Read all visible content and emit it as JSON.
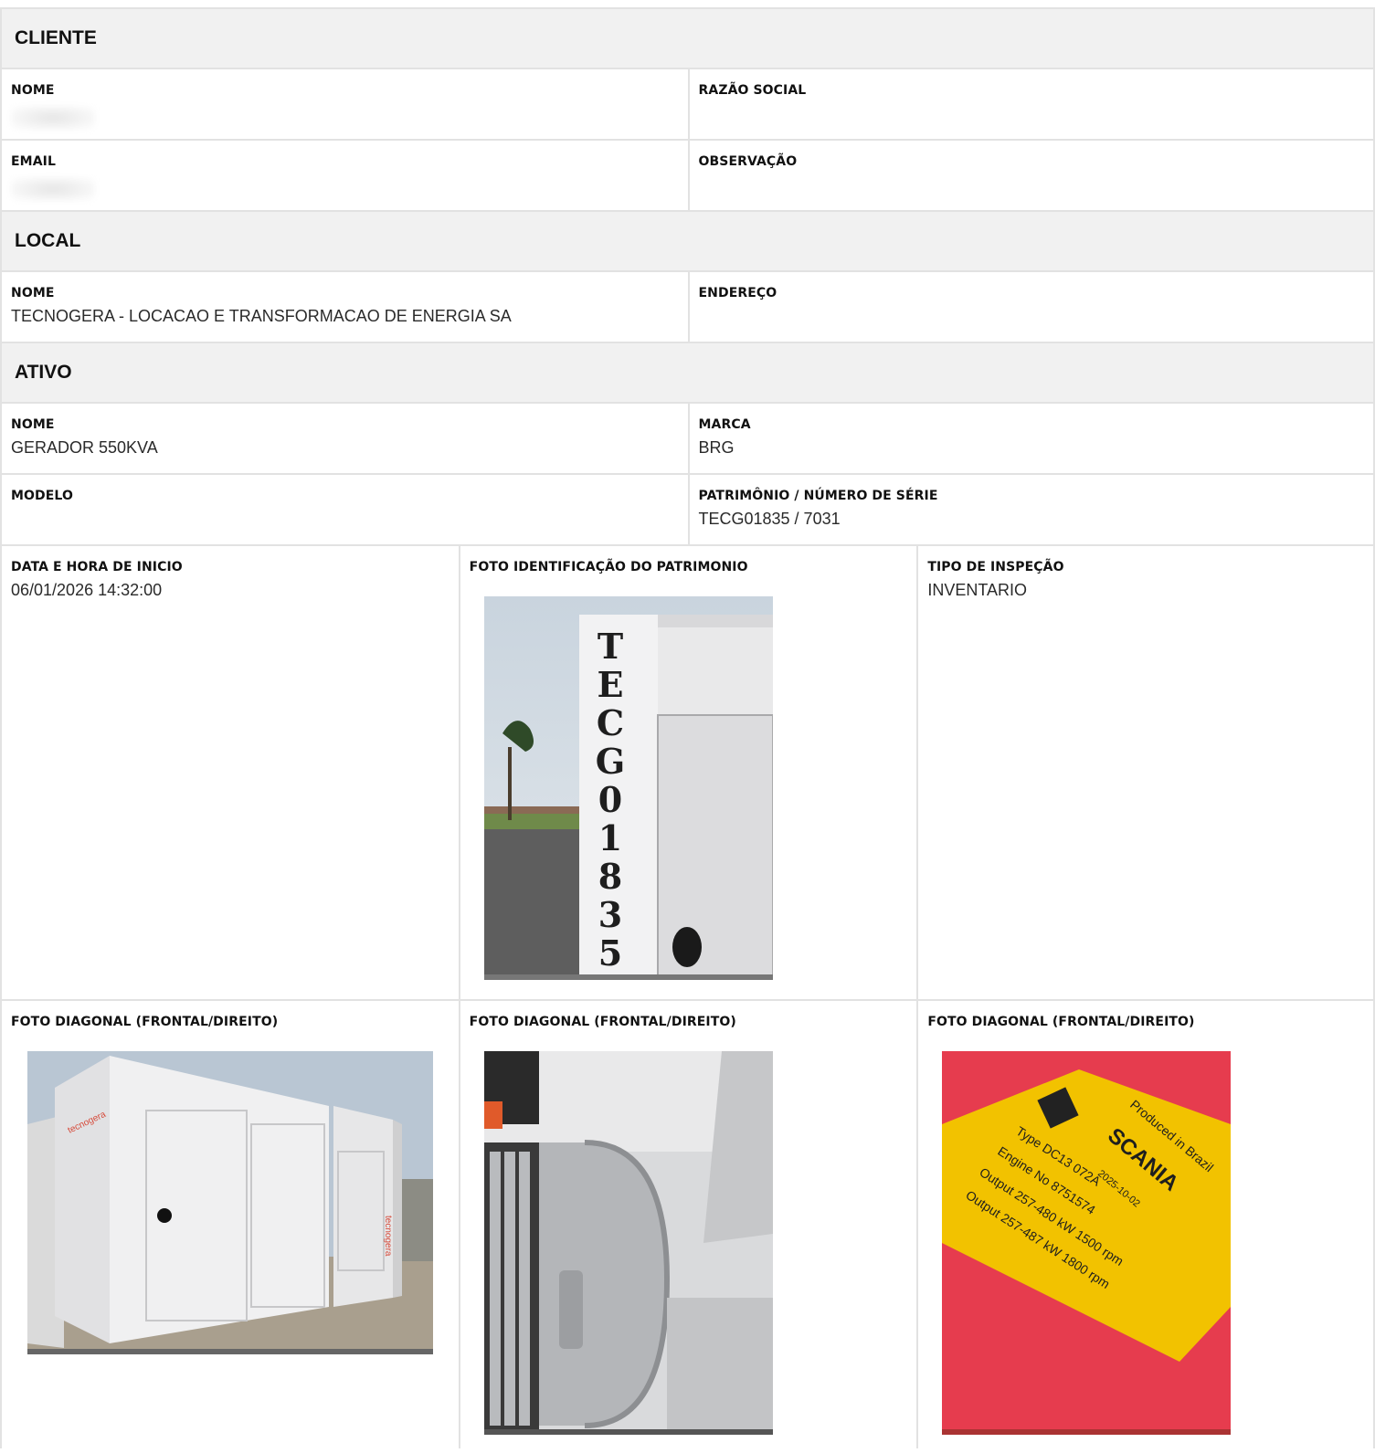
{
  "cliente": {
    "title": "CLIENTE",
    "nome_label": "NOME",
    "razao_label": "RAZÃO SOCIAL",
    "email_label": "EMAIL",
    "obs_label": "OBSERVAÇÃO"
  },
  "local": {
    "title": "LOCAL",
    "nome_label": "NOME",
    "nome_value": "TECNOGERA - LOCACAO E TRANSFORMACAO DE ENERGIA SA",
    "endereco_label": "ENDEREÇO"
  },
  "ativo": {
    "title": "ATIVO",
    "nome_label": "NOME",
    "nome_value": "GERADOR 550KVA",
    "marca_label": "MARCA",
    "marca_value": "BRG",
    "modelo_label": "MODELO",
    "patrimonio_label": "PATRIMÔNIO / NÚMERO DE SÉRIE",
    "patrimonio_value": "TECG01835 / 7031"
  },
  "inspecao": {
    "data_label": "DATA E HORA DE INICIO",
    "data_value": "06/01/2026 14:32:00",
    "foto_id_label": "FOTO IDENTIFICAÇÃO DO PATRIMONIO",
    "tipo_label": "TIPO DE INSPEÇÃO",
    "tipo_value": "INVENTARIO"
  },
  "fotos": [
    {
      "label": "FOTO DIAGONAL (FRONTAL/DIREITO)"
    },
    {
      "label": "FOTO DIAGONAL (FRONTAL/DIREITO)"
    },
    {
      "label": "FOTO DIAGONAL (FRONTAL/DIREITO)"
    }
  ],
  "photo_text": {
    "stencil": [
      "T",
      "E",
      "C",
      "G",
      "0",
      "1",
      "8",
      "3",
      "5"
    ],
    "plate": {
      "brand": "SCANIA",
      "produced": "Produced in Brazil",
      "type": "Type DC13 072A",
      "date": "2025-10-02",
      "engine": "Engine No 8751574",
      "output1": "Output 257-480 kW  1500 rpm",
      "output2": "Output 257-487 kW  1800 rpm"
    }
  },
  "colors": {
    "header_bg": "#f1f1f1",
    "border": "#e2e2e2",
    "plate_yellow": "#f2c200",
    "housing_red": "#e63c4e"
  }
}
